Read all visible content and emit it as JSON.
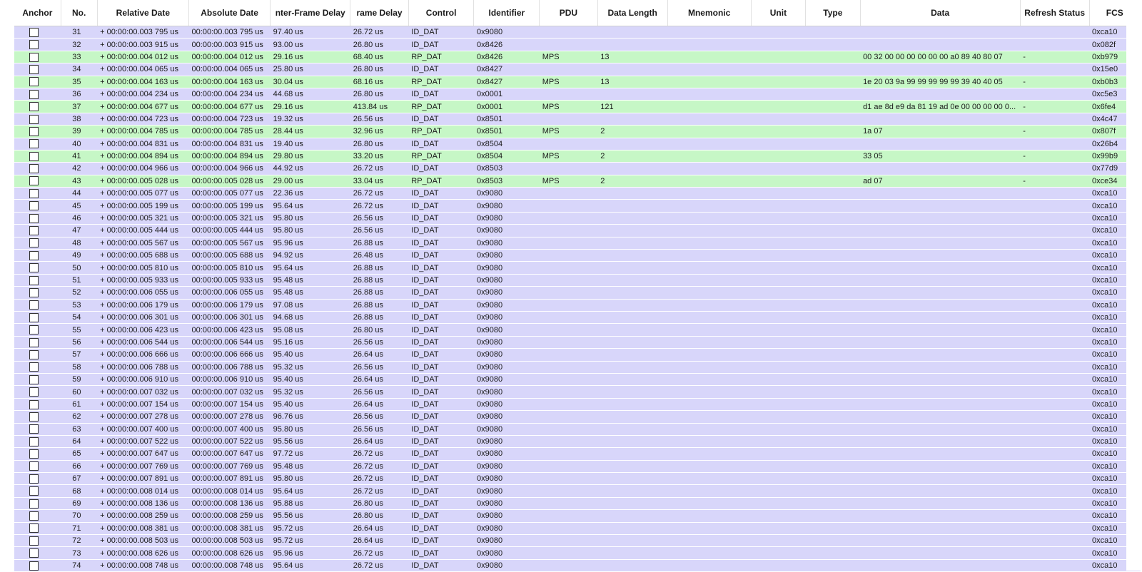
{
  "table": {
    "headers": {
      "anchor": "Anchor",
      "no": "No.",
      "relative_date": "Relative Date",
      "absolute_date": "Absolute Date",
      "inter_frame_delay": "nter-Frame Delay",
      "frame_delay": "rame Delay",
      "control": "Control",
      "identifier": "Identifier",
      "pdu": "PDU",
      "data_length": "Data Length",
      "mnemonic": "Mnemonic",
      "unit": "Unit",
      "type": "Type",
      "data": "Data",
      "refresh_status": "Refresh Status",
      "fcs": "FCS"
    },
    "rows": [
      {
        "no": "31",
        "rel": "+ 00:00:00.003 795 us",
        "abs": "00:00:00.003 795 us",
        "ifd": "97.40 us",
        "fd": "26.72 us",
        "ctrl": "ID_DAT",
        "id": "0x9080",
        "pdu": "",
        "len": "",
        "data": "",
        "ref": "",
        "fcs": "0xca10"
      },
      {
        "no": "32",
        "rel": "+ 00:00:00.003 915 us",
        "abs": "00:00:00.003 915 us",
        "ifd": "93.00 us",
        "fd": "26.80 us",
        "ctrl": "ID_DAT",
        "id": "0x8426",
        "pdu": "",
        "len": "",
        "data": "",
        "ref": "",
        "fcs": "0x082f"
      },
      {
        "no": "33",
        "rel": "+ 00:00:00.004 012 us",
        "abs": "00:00:00.004 012 us",
        "ifd": "29.16 us",
        "fd": "68.40 us",
        "ctrl": "RP_DAT",
        "id": "0x8426",
        "pdu": "MPS",
        "len": "13",
        "data": "00 32 00 00 00 00 00 00 a0 89 40 80 07",
        "ref": "-",
        "fcs": "0xb979"
      },
      {
        "no": "34",
        "rel": "+ 00:00:00.004 065 us",
        "abs": "00:00:00.004 065 us",
        "ifd": "25.80 us",
        "fd": "26.80 us",
        "ctrl": "ID_DAT",
        "id": "0x8427",
        "pdu": "",
        "len": "",
        "data": "",
        "ref": "",
        "fcs": "0x15e0"
      },
      {
        "no": "35",
        "rel": "+ 00:00:00.004 163 us",
        "abs": "00:00:00.004 163 us",
        "ifd": "30.04 us",
        "fd": "68.16 us",
        "ctrl": "RP_DAT",
        "id": "0x8427",
        "pdu": "MPS",
        "len": "13",
        "data": "1e 20 03 9a 99 99 99 99 99 39 40 40 05",
        "ref": "-",
        "fcs": "0xb0b3"
      },
      {
        "no": "36",
        "rel": "+ 00:00:00.004 234 us",
        "abs": "00:00:00.004 234 us",
        "ifd": "44.68 us",
        "fd": "26.80 us",
        "ctrl": "ID_DAT",
        "id": "0x0001",
        "pdu": "",
        "len": "",
        "data": "",
        "ref": "",
        "fcs": "0xc5e3"
      },
      {
        "no": "37",
        "rel": "+ 00:00:00.004 677 us",
        "abs": "00:00:00.004 677 us",
        "ifd": "29.16 us",
        "fd": "413.84 us",
        "ctrl": "RP_DAT",
        "id": "0x0001",
        "pdu": "MPS",
        "len": "121",
        "data": "d1 ae 8d e9 da 81 19 ad 0e 00 00 00 00 0...",
        "ref": "-",
        "fcs": "0x6fe4"
      },
      {
        "no": "38",
        "rel": "+ 00:00:00.004 723 us",
        "abs": "00:00:00.004 723 us",
        "ifd": "19.32 us",
        "fd": "26.56 us",
        "ctrl": "ID_DAT",
        "id": "0x8501",
        "pdu": "",
        "len": "",
        "data": "",
        "ref": "",
        "fcs": "0x4c47"
      },
      {
        "no": "39",
        "rel": "+ 00:00:00.004 785 us",
        "abs": "00:00:00.004 785 us",
        "ifd": "28.44 us",
        "fd": "32.96 us",
        "ctrl": "RP_DAT",
        "id": "0x8501",
        "pdu": "MPS",
        "len": "2",
        "data": "1a 07",
        "ref": "-",
        "fcs": "0x807f"
      },
      {
        "no": "40",
        "rel": "+ 00:00:00.004 831 us",
        "abs": "00:00:00.004 831 us",
        "ifd": "19.40 us",
        "fd": "26.80 us",
        "ctrl": "ID_DAT",
        "id": "0x8504",
        "pdu": "",
        "len": "",
        "data": "",
        "ref": "",
        "fcs": "0x26b4"
      },
      {
        "no": "41",
        "rel": "+ 00:00:00.004 894 us",
        "abs": "00:00:00.004 894 us",
        "ifd": "29.80 us",
        "fd": "33.20 us",
        "ctrl": "RP_DAT",
        "id": "0x8504",
        "pdu": "MPS",
        "len": "2",
        "data": "33 05",
        "ref": "-",
        "fcs": "0x99b9"
      },
      {
        "no": "42",
        "rel": "+ 00:00:00.004 966 us",
        "abs": "00:00:00.004 966 us",
        "ifd": "44.92 us",
        "fd": "26.72 us",
        "ctrl": "ID_DAT",
        "id": "0x8503",
        "pdu": "",
        "len": "",
        "data": "",
        "ref": "",
        "fcs": "0x77d9"
      },
      {
        "no": "43",
        "rel": "+ 00:00:00.005 028 us",
        "abs": "00:00:00.005 028 us",
        "ifd": "29.00 us",
        "fd": "33.04 us",
        "ctrl": "RP_DAT",
        "id": "0x8503",
        "pdu": "MPS",
        "len": "2",
        "data": "ad 07",
        "ref": "-",
        "fcs": "0xce34"
      },
      {
        "no": "44",
        "rel": "+ 00:00:00.005 077 us",
        "abs": "00:00:00.005 077 us",
        "ifd": "22.36 us",
        "fd": "26.72 us",
        "ctrl": "ID_DAT",
        "id": "0x9080",
        "pdu": "",
        "len": "",
        "data": "",
        "ref": "",
        "fcs": "0xca10"
      },
      {
        "no": "45",
        "rel": "+ 00:00:00.005 199 us",
        "abs": "00:00:00.005 199 us",
        "ifd": "95.64 us",
        "fd": "26.72 us",
        "ctrl": "ID_DAT",
        "id": "0x9080",
        "pdu": "",
        "len": "",
        "data": "",
        "ref": "",
        "fcs": "0xca10"
      },
      {
        "no": "46",
        "rel": "+ 00:00:00.005 321 us",
        "abs": "00:00:00.005 321 us",
        "ifd": "95.80 us",
        "fd": "26.56 us",
        "ctrl": "ID_DAT",
        "id": "0x9080",
        "pdu": "",
        "len": "",
        "data": "",
        "ref": "",
        "fcs": "0xca10"
      },
      {
        "no": "47",
        "rel": "+ 00:00:00.005 444 us",
        "abs": "00:00:00.005 444 us",
        "ifd": "95.80 us",
        "fd": "26.56 us",
        "ctrl": "ID_DAT",
        "id": "0x9080",
        "pdu": "",
        "len": "",
        "data": "",
        "ref": "",
        "fcs": "0xca10"
      },
      {
        "no": "48",
        "rel": "+ 00:00:00.005 567 us",
        "abs": "00:00:00.005 567 us",
        "ifd": "95.96 us",
        "fd": "26.88 us",
        "ctrl": "ID_DAT",
        "id": "0x9080",
        "pdu": "",
        "len": "",
        "data": "",
        "ref": "",
        "fcs": "0xca10"
      },
      {
        "no": "49",
        "rel": "+ 00:00:00.005 688 us",
        "abs": "00:00:00.005 688 us",
        "ifd": "94.92 us",
        "fd": "26.48 us",
        "ctrl": "ID_DAT",
        "id": "0x9080",
        "pdu": "",
        "len": "",
        "data": "",
        "ref": "",
        "fcs": "0xca10"
      },
      {
        "no": "50",
        "rel": "+ 00:00:00.005 810 us",
        "abs": "00:00:00.005 810 us",
        "ifd": "95.64 us",
        "fd": "26.88 us",
        "ctrl": "ID_DAT",
        "id": "0x9080",
        "pdu": "",
        "len": "",
        "data": "",
        "ref": "",
        "fcs": "0xca10"
      },
      {
        "no": "51",
        "rel": "+ 00:00:00.005 933 us",
        "abs": "00:00:00.005 933 us",
        "ifd": "95.48 us",
        "fd": "26.88 us",
        "ctrl": "ID_DAT",
        "id": "0x9080",
        "pdu": "",
        "len": "",
        "data": "",
        "ref": "",
        "fcs": "0xca10"
      },
      {
        "no": "52",
        "rel": "+ 00:00:00.006 055 us",
        "abs": "00:00:00.006 055 us",
        "ifd": "95.48 us",
        "fd": "26.88 us",
        "ctrl": "ID_DAT",
        "id": "0x9080",
        "pdu": "",
        "len": "",
        "data": "",
        "ref": "",
        "fcs": "0xca10"
      },
      {
        "no": "53",
        "rel": "+ 00:00:00.006 179 us",
        "abs": "00:00:00.006 179 us",
        "ifd": "97.08 us",
        "fd": "26.88 us",
        "ctrl": "ID_DAT",
        "id": "0x9080",
        "pdu": "",
        "len": "",
        "data": "",
        "ref": "",
        "fcs": "0xca10"
      },
      {
        "no": "54",
        "rel": "+ 00:00:00.006 301 us",
        "abs": "00:00:00.006 301 us",
        "ifd": "94.68 us",
        "fd": "26.88 us",
        "ctrl": "ID_DAT",
        "id": "0x9080",
        "pdu": "",
        "len": "",
        "data": "",
        "ref": "",
        "fcs": "0xca10"
      },
      {
        "no": "55",
        "rel": "+ 00:00:00.006 423 us",
        "abs": "00:00:00.006 423 us",
        "ifd": "95.08 us",
        "fd": "26.80 us",
        "ctrl": "ID_DAT",
        "id": "0x9080",
        "pdu": "",
        "len": "",
        "data": "",
        "ref": "",
        "fcs": "0xca10"
      },
      {
        "no": "56",
        "rel": "+ 00:00:00.006 544 us",
        "abs": "00:00:00.006 544 us",
        "ifd": "95.16 us",
        "fd": "26.56 us",
        "ctrl": "ID_DAT",
        "id": "0x9080",
        "pdu": "",
        "len": "",
        "data": "",
        "ref": "",
        "fcs": "0xca10"
      },
      {
        "no": "57",
        "rel": "+ 00:00:00.006 666 us",
        "abs": "00:00:00.006 666 us",
        "ifd": "95.40 us",
        "fd": "26.64 us",
        "ctrl": "ID_DAT",
        "id": "0x9080",
        "pdu": "",
        "len": "",
        "data": "",
        "ref": "",
        "fcs": "0xca10"
      },
      {
        "no": "58",
        "rel": "+ 00:00:00.006 788 us",
        "abs": "00:00:00.006 788 us",
        "ifd": "95.32 us",
        "fd": "26.56 us",
        "ctrl": "ID_DAT",
        "id": "0x9080",
        "pdu": "",
        "len": "",
        "data": "",
        "ref": "",
        "fcs": "0xca10"
      },
      {
        "no": "59",
        "rel": "+ 00:00:00.006 910 us",
        "abs": "00:00:00.006 910 us",
        "ifd": "95.40 us",
        "fd": "26.64 us",
        "ctrl": "ID_DAT",
        "id": "0x9080",
        "pdu": "",
        "len": "",
        "data": "",
        "ref": "",
        "fcs": "0xca10"
      },
      {
        "no": "60",
        "rel": "+ 00:00:00.007 032 us",
        "abs": "00:00:00.007 032 us",
        "ifd": "95.32 us",
        "fd": "26.56 us",
        "ctrl": "ID_DAT",
        "id": "0x9080",
        "pdu": "",
        "len": "",
        "data": "",
        "ref": "",
        "fcs": "0xca10"
      },
      {
        "no": "61",
        "rel": "+ 00:00:00.007 154 us",
        "abs": "00:00:00.007 154 us",
        "ifd": "95.40 us",
        "fd": "26.64 us",
        "ctrl": "ID_DAT",
        "id": "0x9080",
        "pdu": "",
        "len": "",
        "data": "",
        "ref": "",
        "fcs": "0xca10"
      },
      {
        "no": "62",
        "rel": "+ 00:00:00.007 278 us",
        "abs": "00:00:00.007 278 us",
        "ifd": "96.76 us",
        "fd": "26.56 us",
        "ctrl": "ID_DAT",
        "id": "0x9080",
        "pdu": "",
        "len": "",
        "data": "",
        "ref": "",
        "fcs": "0xca10"
      },
      {
        "no": "63",
        "rel": "+ 00:00:00.007 400 us",
        "abs": "00:00:00.007 400 us",
        "ifd": "95.80 us",
        "fd": "26.56 us",
        "ctrl": "ID_DAT",
        "id": "0x9080",
        "pdu": "",
        "len": "",
        "data": "",
        "ref": "",
        "fcs": "0xca10"
      },
      {
        "no": "64",
        "rel": "+ 00:00:00.007 522 us",
        "abs": "00:00:00.007 522 us",
        "ifd": "95.56 us",
        "fd": "26.64 us",
        "ctrl": "ID_DAT",
        "id": "0x9080",
        "pdu": "",
        "len": "",
        "data": "",
        "ref": "",
        "fcs": "0xca10"
      },
      {
        "no": "65",
        "rel": "+ 00:00:00.007 647 us",
        "abs": "00:00:00.007 647 us",
        "ifd": "97.72 us",
        "fd": "26.72 us",
        "ctrl": "ID_DAT",
        "id": "0x9080",
        "pdu": "",
        "len": "",
        "data": "",
        "ref": "",
        "fcs": "0xca10"
      },
      {
        "no": "66",
        "rel": "+ 00:00:00.007 769 us",
        "abs": "00:00:00.007 769 us",
        "ifd": "95.48 us",
        "fd": "26.72 us",
        "ctrl": "ID_DAT",
        "id": "0x9080",
        "pdu": "",
        "len": "",
        "data": "",
        "ref": "",
        "fcs": "0xca10"
      },
      {
        "no": "67",
        "rel": "+ 00:00:00.007 891 us",
        "abs": "00:00:00.007 891 us",
        "ifd": "95.80 us",
        "fd": "26.72 us",
        "ctrl": "ID_DAT",
        "id": "0x9080",
        "pdu": "",
        "len": "",
        "data": "",
        "ref": "",
        "fcs": "0xca10"
      },
      {
        "no": "68",
        "rel": "+ 00:00:00.008 014 us",
        "abs": "00:00:00.008 014 us",
        "ifd": "95.64 us",
        "fd": "26.72 us",
        "ctrl": "ID_DAT",
        "id": "0x9080",
        "pdu": "",
        "len": "",
        "data": "",
        "ref": "",
        "fcs": "0xca10"
      },
      {
        "no": "69",
        "rel": "+ 00:00:00.008 136 us",
        "abs": "00:00:00.008 136 us",
        "ifd": "95.88 us",
        "fd": "26.80 us",
        "ctrl": "ID_DAT",
        "id": "0x9080",
        "pdu": "",
        "len": "",
        "data": "",
        "ref": "",
        "fcs": "0xca10"
      },
      {
        "no": "70",
        "rel": "+ 00:00:00.008 259 us",
        "abs": "00:00:00.008 259 us",
        "ifd": "95.56 us",
        "fd": "26.80 us",
        "ctrl": "ID_DAT",
        "id": "0x9080",
        "pdu": "",
        "len": "",
        "data": "",
        "ref": "",
        "fcs": "0xca10"
      },
      {
        "no": "71",
        "rel": "+ 00:00:00.008 381 us",
        "abs": "00:00:00.008 381 us",
        "ifd": "95.72 us",
        "fd": "26.64 us",
        "ctrl": "ID_DAT",
        "id": "0x9080",
        "pdu": "",
        "len": "",
        "data": "",
        "ref": "",
        "fcs": "0xca10"
      },
      {
        "no": "72",
        "rel": "+ 00:00:00.008 503 us",
        "abs": "00:00:00.008 503 us",
        "ifd": "95.72 us",
        "fd": "26.64 us",
        "ctrl": "ID_DAT",
        "id": "0x9080",
        "pdu": "",
        "len": "",
        "data": "",
        "ref": "",
        "fcs": "0xca10"
      },
      {
        "no": "73",
        "rel": "+ 00:00:00.008 626 us",
        "abs": "00:00:00.008 626 us",
        "ifd": "95.96 us",
        "fd": "26.72 us",
        "ctrl": "ID_DAT",
        "id": "0x9080",
        "pdu": "",
        "len": "",
        "data": "",
        "ref": "",
        "fcs": "0xca10"
      },
      {
        "no": "74",
        "rel": "+ 00:00:00.008 748 us",
        "abs": "00:00:00.008 748 us",
        "ifd": "95.64 us",
        "fd": "26.72 us",
        "ctrl": "ID_DAT",
        "id": "0x9080",
        "pdu": "",
        "len": "",
        "data": "",
        "ref": "",
        "fcs": "0xca10"
      }
    ]
  },
  "colors": {
    "rp_dat_row": "#c6f7c6",
    "id_dat_row": "#d8d6fa",
    "header_bg": "#ffffff"
  },
  "icons": {
    "anchor_checkbox": "checkbox-icon"
  }
}
